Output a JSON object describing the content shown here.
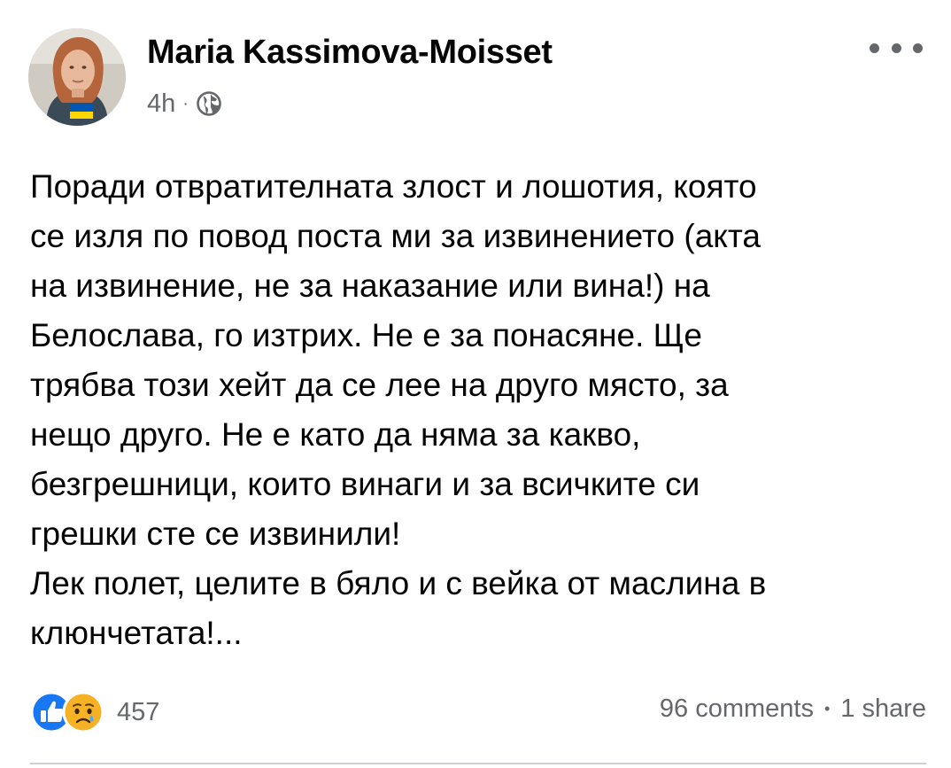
{
  "post": {
    "author": "Maria Kassimova-Moisset",
    "time": "4h",
    "separator": "·",
    "audience_icon": "globe-icon",
    "more_icon": "more-options-icon",
    "text_lines": [
      "Поради отвратителната злост и лошотия, която",
      "се изля по повод поста ми за  извинението (акта",
      "на извинение, не за наказание или вина!) на",
      "Белослава, го изтрих. Не е за понасяне. Ще",
      "трябва този хейт да се лее на друго място, за",
      "нещо друго. Не е като да няма за какво,",
      "безгрешници, които винаги и за всичките си",
      "грешки сте се извинили!",
      "Лек полет, целите в бяло и с вейка от маслина в",
      "клюнчетата!..."
    ]
  },
  "reactions": {
    "icons": [
      "like-icon",
      "sad-icon"
    ],
    "count": "457"
  },
  "stats": {
    "comments": "96 comments",
    "separator": "•",
    "shares": "1 share"
  },
  "colors": {
    "text": "#050505",
    "secondary_text": "#65676b",
    "like_blue": "#1877f2",
    "sad_yellow": "#f7b125",
    "divider": "#ced0d4",
    "flag_blue": "#0057b7",
    "flag_yellow": "#ffd700"
  }
}
